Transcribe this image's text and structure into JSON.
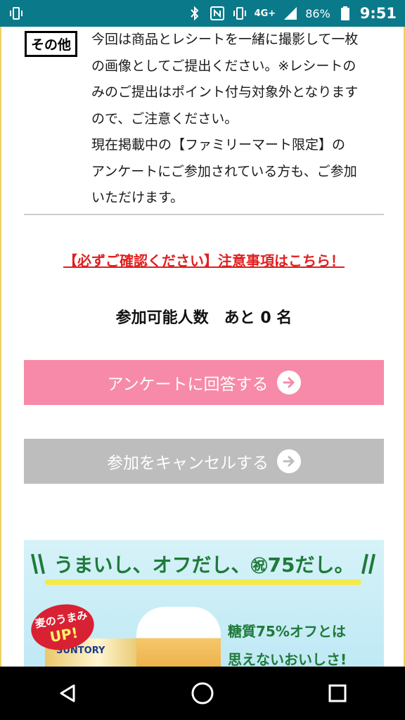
{
  "status_bar": {
    "network": "4G+",
    "battery": "86%",
    "time": "9:51"
  },
  "content": {
    "tag_label": "その他",
    "paragraph_lines": [
      "今回は商品とレシートを一緒に撮影して一枚",
      "の画像としてご提出ください。※レシートの",
      "みのご提出はポイント付与対象外となります",
      "ので、ご注意ください。",
      "現在掲載中の【ファミリーマート限定】の",
      "アンケートにご参加されている方も、ご参加",
      "いただけます。"
    ],
    "notice_link": "【必ずご確認ください】注意事項はこちら！",
    "capacity_text": "参加可能人数　あと 0 名",
    "answer_button": "アンケートに回答する",
    "cancel_button": "参加をキャンセルする"
  },
  "banner": {
    "headline_pre": "うまいし、オフだし、",
    "headline_mark": "㊗",
    "headline_post": "75だし。",
    "badge_line1": "麦のうまみ",
    "badge_line2": "UP!",
    "can_brand": "SUNTORY",
    "copy_line1": "糖質75%オフとは",
    "copy_line2": "思えないおいしさ!"
  },
  "colors": {
    "status_bar": "#0a7a8a",
    "answer_button": "#f78aa8",
    "cancel_button": "#bdbdbd",
    "notice_red": "#e02020"
  }
}
